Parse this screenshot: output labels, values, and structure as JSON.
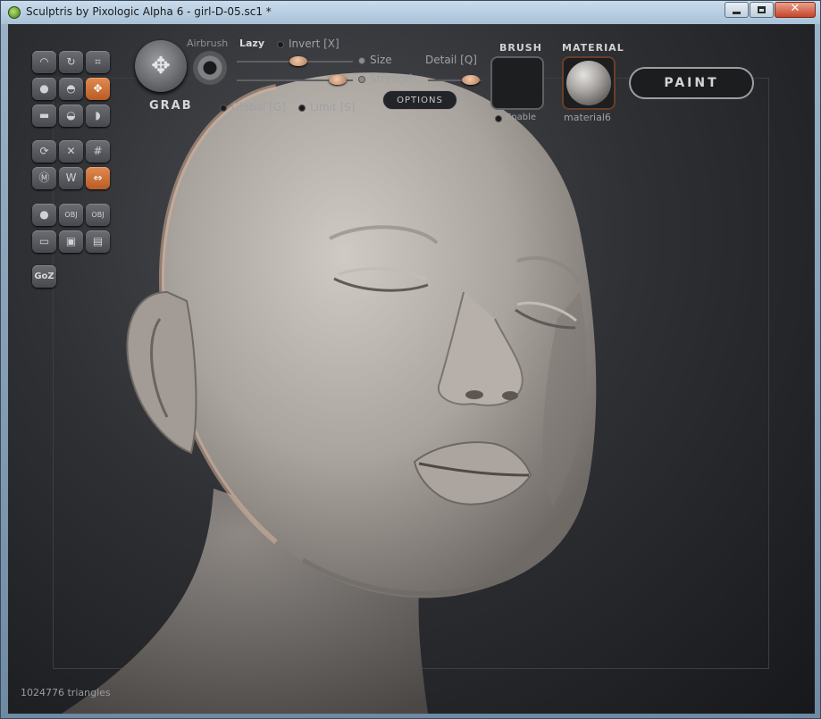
{
  "window": {
    "title": "Sculptris by Pixologic Alpha 6 - girl-D-05.sc1 *",
    "min_icon": "minimize-icon",
    "max_icon": "maximize-icon",
    "close_glyph": "✕"
  },
  "toolbar": {
    "grab_label": "GRAB",
    "airbrush": "Airbrush",
    "lazy": "Lazy",
    "invert": "Invert [X]",
    "size": "Size",
    "detail": "Detail [Q]",
    "strength": "Strength",
    "global": "Global [G]",
    "limit": "Limit [S]",
    "options": "OPTIONS",
    "brush_label": "BRUSH",
    "enable_label": "Enable",
    "material_label": "MATERIAL",
    "material_name": "material6",
    "paint": "PAINT",
    "settings": {
      "size": 0.57,
      "strength": 0.85,
      "detail": 0.8
    }
  },
  "tools": [
    {
      "name": "crease-tool",
      "glyph": "◠",
      "active": false
    },
    {
      "name": "rotate-tool",
      "glyph": "↻",
      "active": false
    },
    {
      "name": "scale-tool",
      "glyph": "⌗",
      "active": false
    },
    {
      "name": "inflate-tool",
      "glyph": "●",
      "active": false
    },
    {
      "name": "draw-tool",
      "glyph": "◓",
      "active": false
    },
    {
      "name": "grab-tool",
      "glyph": "✥",
      "active": true
    },
    {
      "name": "flatten-tool",
      "glyph": "▬",
      "active": false
    },
    {
      "name": "pinch-tool",
      "glyph": "◒",
      "active": false
    },
    {
      "name": "smooth-tool",
      "glyph": "◗",
      "active": false
    },
    {
      "name": "subdivide-tool",
      "glyph": "⟳",
      "active": false
    },
    {
      "name": "reduce-tool",
      "glyph": "✕",
      "active": false
    },
    {
      "name": "grid-tool",
      "glyph": "#",
      "active": false
    },
    {
      "name": "mask-tool",
      "glyph": "Ⓜ",
      "active": false
    },
    {
      "name": "wireframe-tool",
      "glyph": "W",
      "active": false
    },
    {
      "name": "symmetry-tool",
      "glyph": "⇔",
      "active": true
    },
    {
      "name": "sphere-tool",
      "glyph": "●",
      "active": false
    },
    {
      "name": "import-obj-tool",
      "glyph": "OBJ",
      "active": false
    },
    {
      "name": "export-obj-tool",
      "glyph": "OBJ",
      "active": false
    },
    {
      "name": "plane-tool",
      "glyph": "▭",
      "active": false
    },
    {
      "name": "open-tool",
      "glyph": "▣",
      "active": false
    },
    {
      "name": "save-tool",
      "glyph": "▤",
      "active": false
    },
    {
      "name": "goz-button",
      "glyph": "GoZ",
      "active": false
    }
  ],
  "status": {
    "triangles": "1024776 triangles"
  },
  "colors": {
    "accent": "#c8672e",
    "viewport_bg": "#2e3034",
    "skin": "#b9b3ad"
  }
}
